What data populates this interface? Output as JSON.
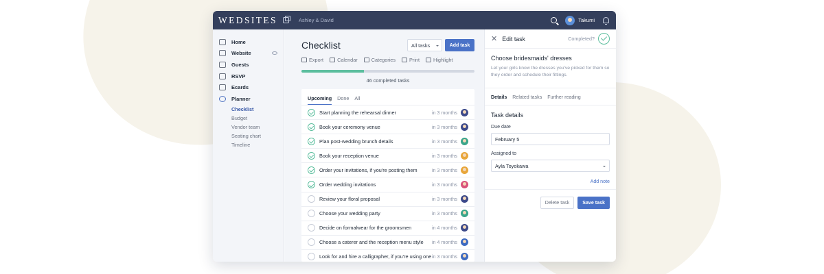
{
  "topbar": {
    "brand": "WEDSITES",
    "site_name": "Ashley & David",
    "user_name": "Takumi"
  },
  "sidebar": {
    "items": [
      {
        "label": "Home",
        "icon": "home-icon"
      },
      {
        "label": "Website",
        "icon": "monitor-icon"
      },
      {
        "label": "Guests",
        "icon": "guests-icon"
      },
      {
        "label": "RSVP",
        "icon": "rsvp-icon"
      },
      {
        "label": "Ecards",
        "icon": "ecard-icon"
      },
      {
        "label": "Planner",
        "icon": "check-circle-icon"
      }
    ],
    "sub_items": [
      "Checklist",
      "Budget",
      "Vendor team",
      "Seating chart",
      "Timeline"
    ]
  },
  "main": {
    "title": "Checklist",
    "filter": "All tasks",
    "add_button": "Add task",
    "tools": [
      "Export",
      "Calendar",
      "Categories",
      "Print",
      "Highlight"
    ],
    "progress": 0.36,
    "completed_text": "46 completed tasks",
    "tabs": [
      "Upcoming",
      "Done",
      "All"
    ],
    "tasks": [
      {
        "name": "Start planning the rehearsal dinner",
        "due": "in 3 months",
        "done": true,
        "avatar_color": "#3d4a8a"
      },
      {
        "name": "Book your ceremony venue",
        "due": "in 3 months",
        "done": true,
        "avatar_color": "#3d4a8a"
      },
      {
        "name": "Plan post-wedding brunch details",
        "due": "in 3 months",
        "done": true,
        "avatar_color": "#3aa58a"
      },
      {
        "name": "Book your reception venue",
        "due": "in 3 months",
        "done": true,
        "avatar_color": "#e8a63a"
      },
      {
        "name": "Order your invitations, if you're posting them",
        "due": "in 3 months",
        "done": true,
        "avatar_color": "#e8a63a"
      },
      {
        "name": "Order wedding invitations",
        "due": "in 3 months",
        "done": true,
        "avatar_color": "#d9527a"
      },
      {
        "name": "Review your floral proposal",
        "due": "in 3 months",
        "done": false,
        "avatar_color": "#3d4a8a"
      },
      {
        "name": "Choose your wedding party",
        "due": "in 3 months",
        "done": false,
        "avatar_color": "#3aa58a"
      },
      {
        "name": "Decide on formalwear for the groomsmen",
        "due": "in 4 months",
        "done": false,
        "avatar_color": "#3d4a8a"
      },
      {
        "name": "Choose a caterer and the reception menu style",
        "due": "in 4 months",
        "done": false,
        "avatar_color": "#3d6ac0"
      },
      {
        "name": "Look for and hire a calligrapher, if you're using one",
        "due": "in 3 months",
        "done": false,
        "avatar_color": "#3d6ac0"
      }
    ]
  },
  "panel": {
    "title": "Edit task",
    "completed_label": "Completed?",
    "task_title": "Choose bridesmaids' dresses",
    "task_desc": "Let your girls know the dresses you've picked for them so they order and schedule their fittings.",
    "tabs": [
      "Details",
      "Related tasks",
      "Further reading"
    ],
    "section_title": "Task details",
    "due_label": "Due date",
    "due_value": "February 5",
    "assigned_label": "Assigned to",
    "assigned_value": "Ayla Toyokawa",
    "add_note": "Add note",
    "delete_button": "Delete task",
    "save_button": "Save task"
  },
  "colors": {
    "topbar": "#343f5c",
    "accent": "#4a72c7",
    "success": "#5cbe9e"
  }
}
